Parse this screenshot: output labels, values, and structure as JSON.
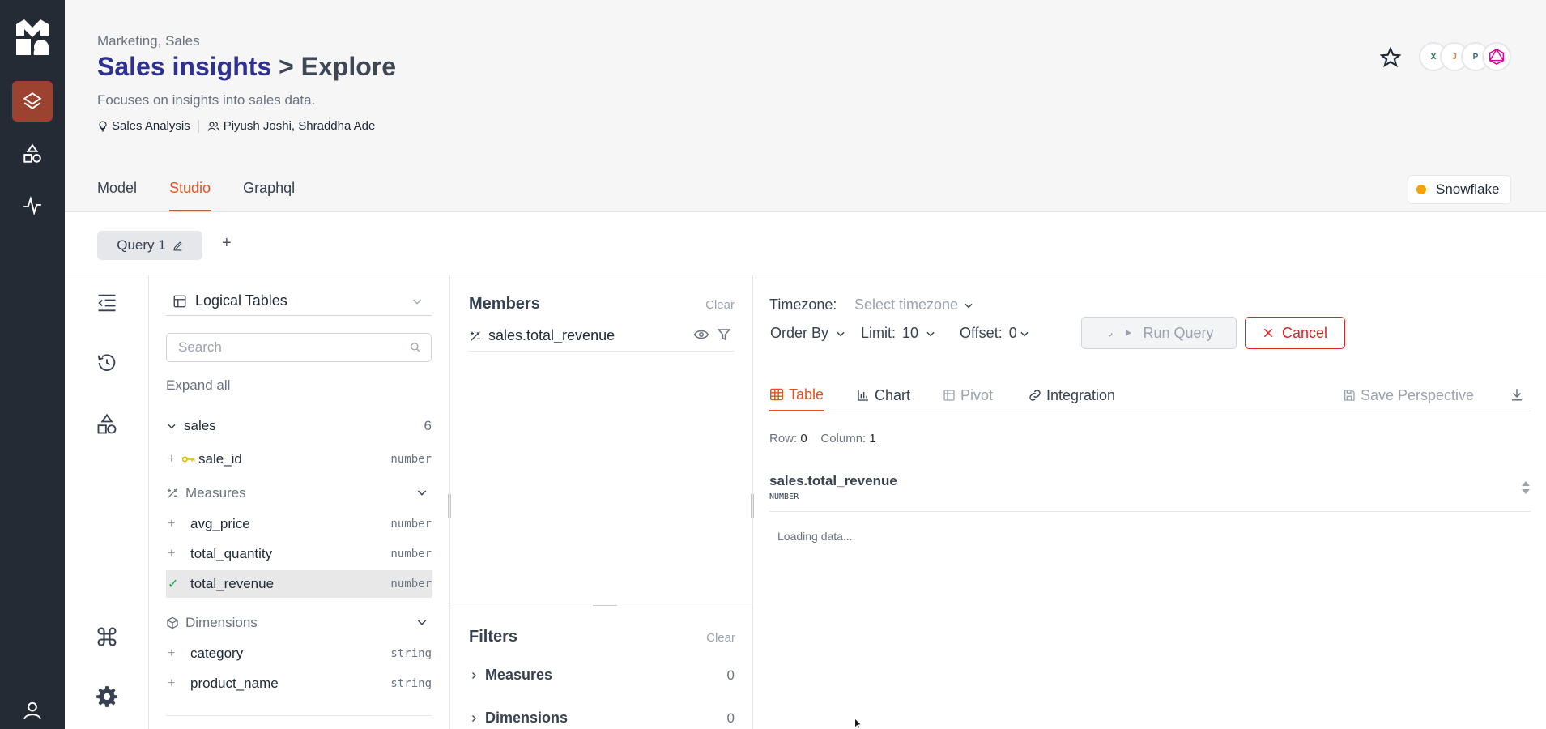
{
  "breadcrumb": "Marketing, Sales",
  "title": {
    "name": "Sales insights",
    "suffix": "> Explore"
  },
  "description": "Focuses on insights into sales data.",
  "meta": {
    "category": "Sales Analysis",
    "owners": "Piyush Joshi, Shraddha Ade"
  },
  "tabs": [
    {
      "label": "Model",
      "active": false
    },
    {
      "label": "Studio",
      "active": true
    },
    {
      "label": "Graphql",
      "active": false
    }
  ],
  "datasource": {
    "label": "Snowflake",
    "status_color": "#f5a300"
  },
  "query_tab": {
    "label": "Query 1",
    "add": "+"
  },
  "tables_panel": {
    "selector": "Logical Tables",
    "search_placeholder": "Search",
    "expand_all": "Expand all",
    "table": {
      "name": "sales",
      "count": "6"
    },
    "key_field": {
      "name": "sale_id",
      "type": "number"
    },
    "measures_label": "Measures",
    "measures": [
      {
        "name": "avg_price",
        "type": "number",
        "selected": false
      },
      {
        "name": "total_quantity",
        "type": "number",
        "selected": false
      },
      {
        "name": "total_revenue",
        "type": "number",
        "selected": true
      }
    ],
    "dimensions_label": "Dimensions",
    "dimensions": [
      {
        "name": "category",
        "type": "string"
      },
      {
        "name": "product_name",
        "type": "string"
      }
    ]
  },
  "members_panel": {
    "title": "Members",
    "clear": "Clear",
    "items": [
      "sales.total_revenue"
    ],
    "filters_title": "Filters",
    "filters_clear": "Clear",
    "filter_groups": [
      {
        "label": "Measures",
        "count": "0"
      },
      {
        "label": "Dimensions",
        "count": "0"
      }
    ]
  },
  "results": {
    "timezone_label": "Timezone:",
    "timezone_placeholder": "Select timezone",
    "order_by": "Order By",
    "limit_label": "Limit:",
    "limit_value": "10",
    "offset_label": "Offset:",
    "offset_value": "0",
    "run_query": "Run Query",
    "cancel": "Cancel",
    "view_tabs": [
      {
        "label": "Table",
        "active": true
      },
      {
        "label": "Chart"
      },
      {
        "label": "Pivot",
        "disabled": true
      },
      {
        "label": "Integration"
      }
    ],
    "save_perspective": "Save Perspective",
    "row_label": "Row:",
    "row_value": "0",
    "column_label": "Column:",
    "column_value": "1",
    "column": {
      "name": "sales.total_revenue",
      "type": "NUMBER"
    },
    "loading": "Loading data..."
  },
  "colors": {
    "accent": "#e8501f",
    "title": "#2e3192",
    "rail": "#252b35",
    "rail_active": "#9c4230"
  }
}
